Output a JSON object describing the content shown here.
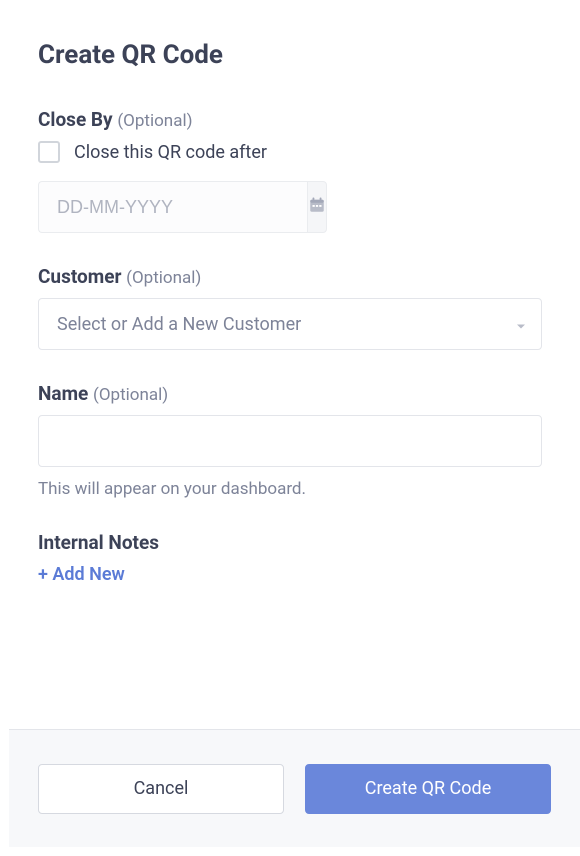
{
  "title": "Create QR Code",
  "closeBy": {
    "label": "Close By",
    "optional": "(Optional)",
    "checkboxLabel": "Close this QR code after",
    "datePlaceholder": "DD-MM-YYYY"
  },
  "customer": {
    "label": "Customer",
    "optional": "(Optional)",
    "placeholder": "Select or Add a New Customer"
  },
  "name": {
    "label": "Name",
    "optional": "(Optional)",
    "helper": "This will appear on your dashboard."
  },
  "internalNotes": {
    "label": "Internal Notes",
    "addNew": "+ Add New"
  },
  "footer": {
    "cancel": "Cancel",
    "submit": "Create QR Code"
  }
}
